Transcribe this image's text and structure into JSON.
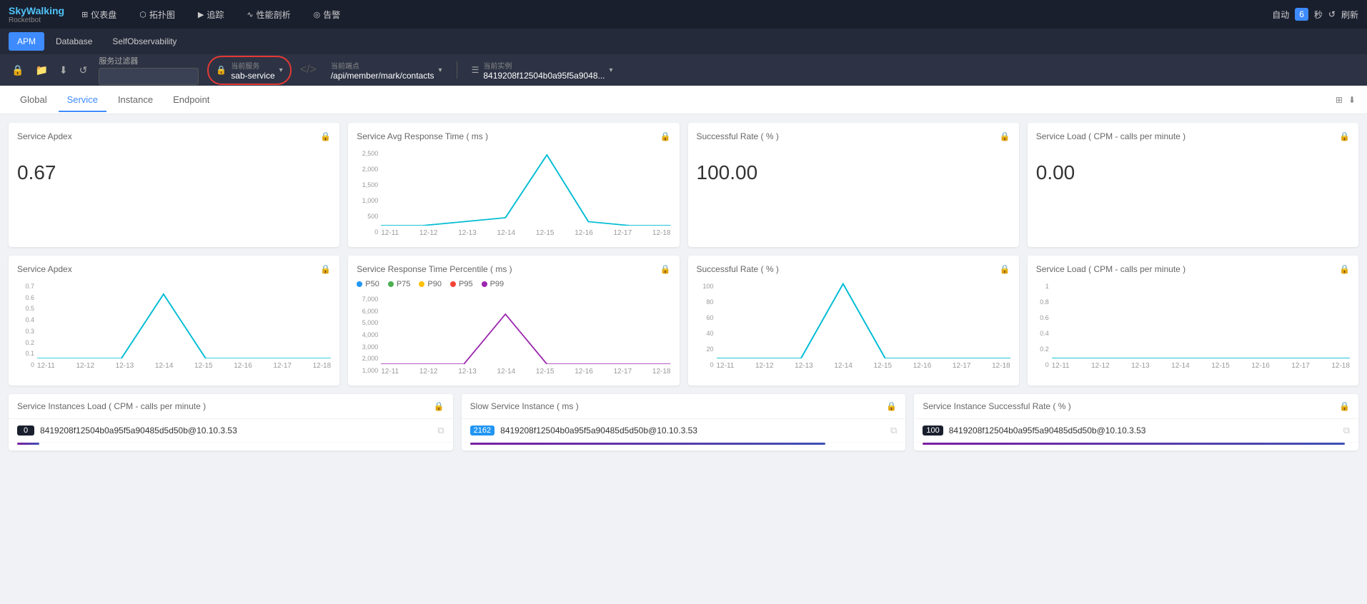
{
  "app": {
    "logo": "SkyWalking",
    "sub": "Rocketbot"
  },
  "topNav": {
    "items": [
      {
        "id": "dashboard",
        "icon": "⊞",
        "label": "仪表盘"
      },
      {
        "id": "topology",
        "icon": "⬡",
        "label": "拓扑图"
      },
      {
        "id": "trace",
        "icon": "▶",
        "label": "追踪"
      },
      {
        "id": "profiling",
        "icon": "∿",
        "label": "性能剖析"
      },
      {
        "id": "alarm",
        "icon": "◎",
        "label": "告警"
      }
    ],
    "right": {
      "auto": "自动",
      "interval": "6",
      "unit1": "秒",
      "refresh": "刷新"
    }
  },
  "apmTabs": [
    {
      "id": "apm",
      "label": "APM",
      "active": true
    },
    {
      "id": "database",
      "label": "Database"
    },
    {
      "id": "self",
      "label": "SelfObservability"
    }
  ],
  "filterBar": {
    "serviceFilterLabel": "服务过滤器",
    "serviceFilterPlaceholder": "",
    "currentServiceLabel": "当前服务",
    "currentServiceValue": "sab-service",
    "currentEndpointLabel": "当前端点",
    "currentEndpointValue": "/api/member/mark/contacts",
    "currentInstanceLabel": "当前实例",
    "currentInstanceValue": "8419208f12504b0a95f5a9048..."
  },
  "dashTabs": [
    {
      "id": "global",
      "label": "Global"
    },
    {
      "id": "service",
      "label": "Service",
      "active": true
    },
    {
      "id": "instance",
      "label": "Instance"
    },
    {
      "id": "endpoint",
      "label": "Endpoint"
    }
  ],
  "cards": {
    "row1": [
      {
        "id": "service-apdex-1",
        "title": "Service Apdex",
        "value": "0.67",
        "type": "metric"
      },
      {
        "id": "service-avg-response",
        "title": "Service Avg Response Time ( ms )",
        "type": "chart",
        "yLabels": [
          "2,500",
          "2,000",
          "1,500",
          "1,000",
          "500",
          "0"
        ],
        "xLabels": [
          "12-11",
          "12-12",
          "12-13",
          "12-14",
          "12-15",
          "12-16",
          "12-17",
          "12-18"
        ],
        "chartColor": "#00bcd4"
      },
      {
        "id": "successful-rate-1",
        "title": "Successful Rate ( % )",
        "value": "100.00",
        "type": "metric"
      },
      {
        "id": "service-load-1",
        "title": "Service Load ( CPM - calls per minute )",
        "value": "0.00",
        "type": "metric"
      }
    ],
    "row2": [
      {
        "id": "service-apdex-2",
        "title": "Service Apdex",
        "type": "chart",
        "yLabels": [
          "0.7",
          "0.6",
          "0.5",
          "0.4",
          "0.3",
          "0.2",
          "0.1",
          "0"
        ],
        "xLabels": [
          "12-11",
          "12-12",
          "12-13",
          "12-14",
          "12-15",
          "12-16",
          "12-17",
          "12-18"
        ],
        "chartColor": "#00bcd4"
      },
      {
        "id": "service-response-percentile",
        "title": "Service Response Time Percentile ( ms )",
        "type": "chart-legend",
        "legend": [
          {
            "label": "P50",
            "color": "#2196f3"
          },
          {
            "label": "P75",
            "color": "#4caf50"
          },
          {
            "label": "P90",
            "color": "#ffc107"
          },
          {
            "label": "P95",
            "color": "#f44336"
          },
          {
            "label": "P99",
            "color": "#9c27b0"
          }
        ],
        "yLabels": [
          "7,000",
          "6,000",
          "5,000",
          "4,000",
          "3,000",
          "2,000",
          "1,000"
        ],
        "xLabels": [
          "12-11",
          "12-12",
          "12-13",
          "12-14",
          "12-15",
          "12-16",
          "12-17",
          "12-18"
        ],
        "chartColor": "#9c27b0"
      },
      {
        "id": "successful-rate-2",
        "title": "Successful Rate ( % )",
        "type": "chart",
        "yLabels": [
          "100",
          "80",
          "60",
          "40",
          "20",
          "0"
        ],
        "xLabels": [
          "12-11",
          "12-12",
          "12-13",
          "12-14",
          "12-15",
          "12-16",
          "12-17",
          "12-18"
        ],
        "chartColor": "#00bcd4"
      },
      {
        "id": "service-load-2",
        "title": "Service Load ( CPM - calls per minute )",
        "type": "chart",
        "yLabels": [
          "1",
          "0.8",
          "0.6",
          "0.4",
          "0.2",
          "0"
        ],
        "xLabels": [
          "12-11",
          "12-12",
          "12-13",
          "12-14",
          "12-15",
          "12-16",
          "12-17",
          "12-18"
        ],
        "chartColor": "#00bcd4"
      }
    ]
  },
  "bottomCards": [
    {
      "id": "service-instances-load",
      "title": "Service Instances Load ( CPM - calls per minute )",
      "items": [
        {
          "badge": "0",
          "badgeClass": "dark",
          "text": "8419208f12504b0a95f5a90485d5d50b@10.10.3.53",
          "barColor": "#7b1fa2"
        }
      ]
    },
    {
      "id": "slow-service-instance",
      "title": "Slow Service Instance ( ms )",
      "items": [
        {
          "badge": "2162",
          "badgeClass": "blue",
          "text": "8419208f12504b0a95f5a90485d5d50b@10.10.3.53",
          "barColor": "#7b1fa2"
        }
      ]
    },
    {
      "id": "service-instance-success-rate",
      "title": "Service Instance Successful Rate ( % )",
      "items": [
        {
          "badge": "100",
          "badgeClass": "dark",
          "text": "8419208f12504b0a95f5a90485d5d50b@10.10.3.53",
          "barColor": "#7b1fa2"
        }
      ]
    }
  ],
  "colors": {
    "accent": "#3d8bff",
    "navBg": "#1a1f2e",
    "apmBg": "#252a3a",
    "filterBg": "#2d3344",
    "chartLine": "#00bcd4",
    "redCircle": "#e53935"
  }
}
